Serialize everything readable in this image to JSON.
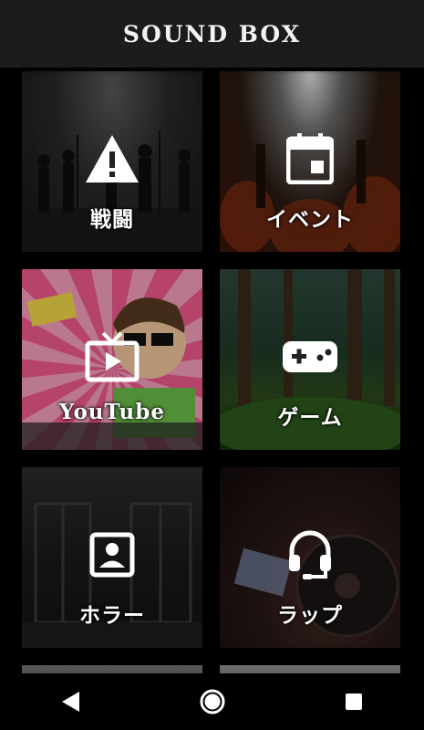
{
  "app": {
    "title": "SOUND BOX"
  },
  "tiles": [
    {
      "label": "戦闘",
      "icon": "warning-icon"
    },
    {
      "label": "イベント",
      "icon": "calendar-icon"
    },
    {
      "label": "YouTube",
      "icon": "tv-play-icon"
    },
    {
      "label": "ゲーム",
      "icon": "gamepad-icon"
    },
    {
      "label": "ホラー",
      "icon": "portrait-icon"
    },
    {
      "label": "ラップ",
      "icon": "headphones-icon"
    }
  ],
  "nav": {
    "back": "back-icon",
    "home": "home-icon",
    "recents": "recents-icon"
  }
}
